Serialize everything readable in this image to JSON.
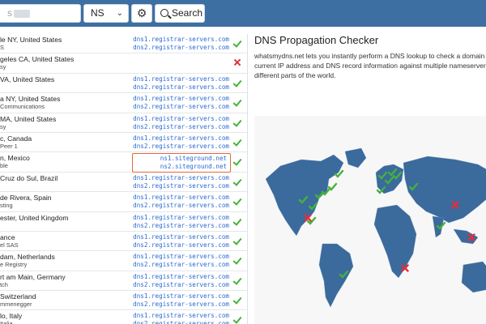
{
  "toolbar": {
    "domain_value": "s",
    "record_type": "NS",
    "search_label": "Search"
  },
  "results": [
    {
      "location": "le NY, United States",
      "provider": "S",
      "ns": [
        "dns1.registrar-servers.com",
        "dns2.registrar-servers.com"
      ],
      "status": "ok"
    },
    {
      "location": "geles CA, United States",
      "provider": "sy",
      "ns": [],
      "status": "fail"
    },
    {
      "location": "VA, United States",
      "provider": "",
      "ns": [
        "dns1.registrar-servers.com",
        "dns2.registrar-servers.com"
      ],
      "status": "ok"
    },
    {
      "location": "a NY, United States",
      "provider": "Communications",
      "ns": [
        "dns1.registrar-servers.com",
        "dns2.registrar-servers.com"
      ],
      "status": "ok"
    },
    {
      "location": "MA, United States",
      "provider": "sy",
      "ns": [
        "dns1.registrar-servers.com",
        "dns2.registrar-servers.com"
      ],
      "status": "ok"
    },
    {
      "location": "c, Canada",
      "provider": "Peer 1",
      "ns": [
        "dns1.registrar-servers.com",
        "dns2.registrar-servers.com"
      ],
      "status": "ok"
    },
    {
      "location": "n, Mexico",
      "provider": "ble",
      "ns": [
        "ns1.siteground.net",
        "ns2.siteground.net"
      ],
      "status": "ok",
      "highlight": true
    },
    {
      "location": "Cruz do Sul, Brazil",
      "provider": "",
      "ns": [
        "dns1.registrar-servers.com",
        "dns2.registrar-servers.com"
      ],
      "status": "ok"
    },
    {
      "location": "de Rivera, Spain",
      "provider": "sting",
      "ns": [
        "dns1.registrar-servers.com",
        "dns2.registrar-servers.com"
      ],
      "status": "ok"
    },
    {
      "location": "ester, United Kingdom",
      "provider": "",
      "ns": [
        "dns1.registrar-servers.com",
        "dns2.registrar-servers.com"
      ],
      "status": "ok"
    },
    {
      "location": "ance",
      "provider": "el SAS",
      "ns": [
        "dns1.registrar-servers.com",
        "dns2.registrar-servers.com"
      ],
      "status": "ok"
    },
    {
      "location": "dam, Netherlands",
      "provider": "e Registry",
      "ns": [
        "dns1.registrar-servers.com",
        "dns2.registrar-servers.com"
      ],
      "status": "ok"
    },
    {
      "location": "rt am Main, Germany",
      "provider": "tch",
      "ns": [
        "dns1.registrar-servers.com",
        "dns2.registrar-servers.com"
      ],
      "status": "ok"
    },
    {
      "location": "Switzerland",
      "provider": "mmenegger",
      "ns": [
        "dns1.registrar-servers.com",
        "dns2.registrar-servers.com"
      ],
      "status": "ok"
    },
    {
      "location": "lo, Italy",
      "provider": "Italia",
      "ns": [
        "dns1.registrar-servers.com",
        "dns2.registrar-servers.com"
      ],
      "status": "ok"
    }
  ],
  "info": {
    "title": "DNS Propagation Checker",
    "lines": [
      "whatsmydns.net lets you instantly perform a DNS lookup to check a domain",
      "current IP address and DNS record information against multiple nameservers",
      "different parts of the world."
    ]
  },
  "map_markers": [
    {
      "status": "ok"
    },
    {
      "status": "ok"
    },
    {
      "status": "ok"
    },
    {
      "status": "ok"
    },
    {
      "status": "ok"
    },
    {
      "status": "ok"
    },
    {
      "status": "ok"
    },
    {
      "status": "ok"
    },
    {
      "status": "ok"
    },
    {
      "status": "ok"
    },
    {
      "status": "ok"
    },
    {
      "status": "ok"
    },
    {
      "status": "ok"
    },
    {
      "status": "ok"
    },
    {
      "status": "ok"
    },
    {
      "status": "fail"
    },
    {
      "status": "fail"
    },
    {
      "status": "fail"
    },
    {
      "status": "fail"
    }
  ],
  "colors": {
    "topbar": "#3d6fa3",
    "land": "#3b6a9c",
    "ok": "#44b23a",
    "fail": "#e0303a",
    "ns_link": "#2a6bd1",
    "highlight": "#e36a3a"
  }
}
